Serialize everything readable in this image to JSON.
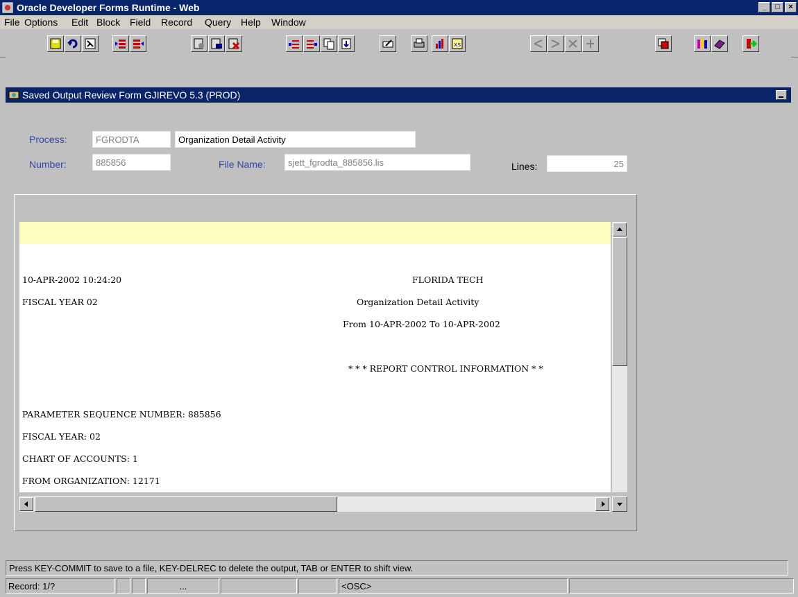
{
  "window": {
    "title": "Oracle Developer Forms Runtime - Web"
  },
  "menu": [
    "File",
    "Options",
    "Edit",
    "Block",
    "Field",
    "Record",
    "Query",
    "Help",
    "Window"
  ],
  "form": {
    "title": "Saved Output Review Form  GJIREVO 5.3  (PROD)"
  },
  "fields": {
    "process_label": "Process:",
    "process_value": "FGRODTA",
    "process_desc": "Organization Detail Activity",
    "number_label": "Number:",
    "number_value": "885856",
    "filename_label": "File Name:",
    "filename_value": "sjett_fgrodta_885856.lis",
    "lines_label": "Lines:",
    "lines_value": "25"
  },
  "report": {
    "line1_left": "10-APR-2002 10:24:20",
    "line1_right": "FLORIDA TECH",
    "line2_left": "FISCAL YEAR 02",
    "line2_right": "Organization Detail Activity",
    "line3_right": "From 10-APR-2002 To 10-APR-2002",
    "line4_right": "* * * REPORT CONTROL INFORMATION * *",
    "param_seq": "PARAMETER SEQUENCE NUMBER: 885856",
    "fiscal_year": "FISCAL YEAR: 02",
    "chart": "CHART OF ACCOUNTS: 1",
    "from_org": "FROM ORGANIZATION: 12171"
  },
  "hint": "Press KEY-COMMIT to save to a file, KEY-DELREC to delete the output, TAB or ENTER to shift view.",
  "status": {
    "record": "Record: 1/?",
    "list_indicator": "...",
    "mode": "<OSC>"
  }
}
